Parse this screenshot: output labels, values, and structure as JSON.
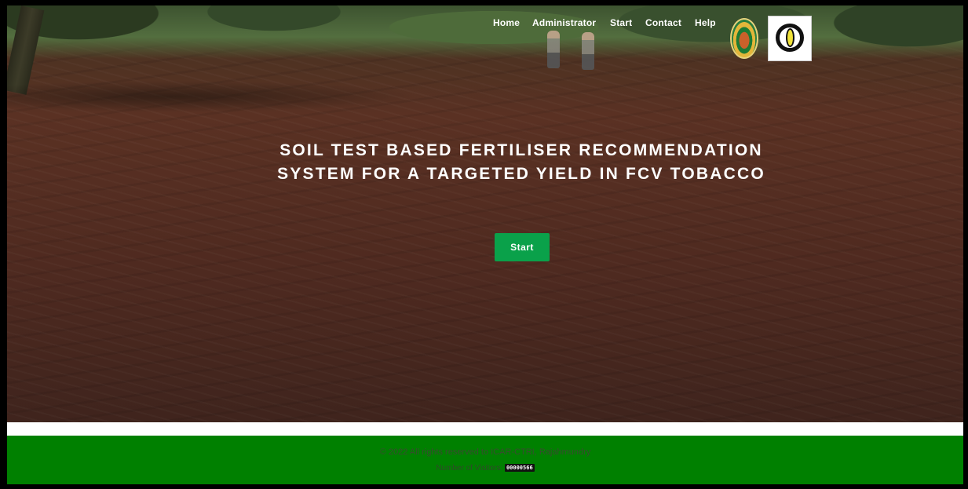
{
  "nav": {
    "items": [
      {
        "label": "Home"
      },
      {
        "label": "Administrator"
      },
      {
        "label": "Start"
      },
      {
        "label": "Contact"
      },
      {
        "label": "Help"
      }
    ]
  },
  "logos": {
    "ctri": {
      "icon": "ctri-emblem-logo"
    },
    "tobacco_board": {
      "icon": "tobacco-board-logo"
    }
  },
  "hero": {
    "title_line1": "SOIL TEST BASED FERTILISER RECOMMENDATION",
    "title_line2": "SYSTEM FOR A TARGETED YIELD IN FCV TOBACCO",
    "start_button": "Start"
  },
  "footer": {
    "copyright": "© 2022 All rights reserved to ICAR-CTRI, Rajahmundry",
    "visitors_label": "Number of Visitors:",
    "visitors_count": "00000566",
    "color": "#008000"
  },
  "colors": {
    "accent_button": "#0aa14a",
    "footer": "#008000",
    "nav_text": "#ffffff"
  }
}
